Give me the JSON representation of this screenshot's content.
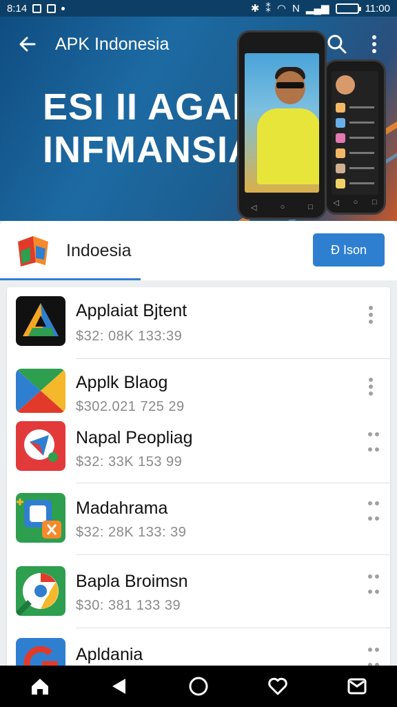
{
  "status_bar": {
    "time": "8:14",
    "right_text": "11:00"
  },
  "header": {
    "title": "APK Indonesia"
  },
  "hero": {
    "headline_line1": "ESI II AGAI",
    "headline_line2": "INFMANSIA"
  },
  "tab_bar": {
    "label": "Indoesia",
    "action_label": "Ð Ison"
  },
  "apps": [
    {
      "name": "Applaiat Bjtent",
      "meta": "$32: 08K 133:39",
      "icon": "triangle-app-icon"
    },
    {
      "name": "Applk Blaog",
      "meta": "$302.021 725 29",
      "icon": "play-store-icon"
    },
    {
      "name": "Napal Peopliag",
      "meta": "$32: 33K 153 99",
      "icon": "maps-app-icon"
    },
    {
      "name": "Madahrama",
      "meta": "$32: 28K 133: 39",
      "icon": "translate-app-icon"
    },
    {
      "name": "Bapla Broimsn",
      "meta": "$30: 381 133 39",
      "icon": "chrome-browser-icon"
    },
    {
      "name": "Apldania",
      "meta": "",
      "icon": "google-app-icon"
    }
  ],
  "colors": {
    "accent": "#2f7fd1",
    "status_bar": "#0d3f66",
    "hero_orange": "#f08a2c"
  }
}
